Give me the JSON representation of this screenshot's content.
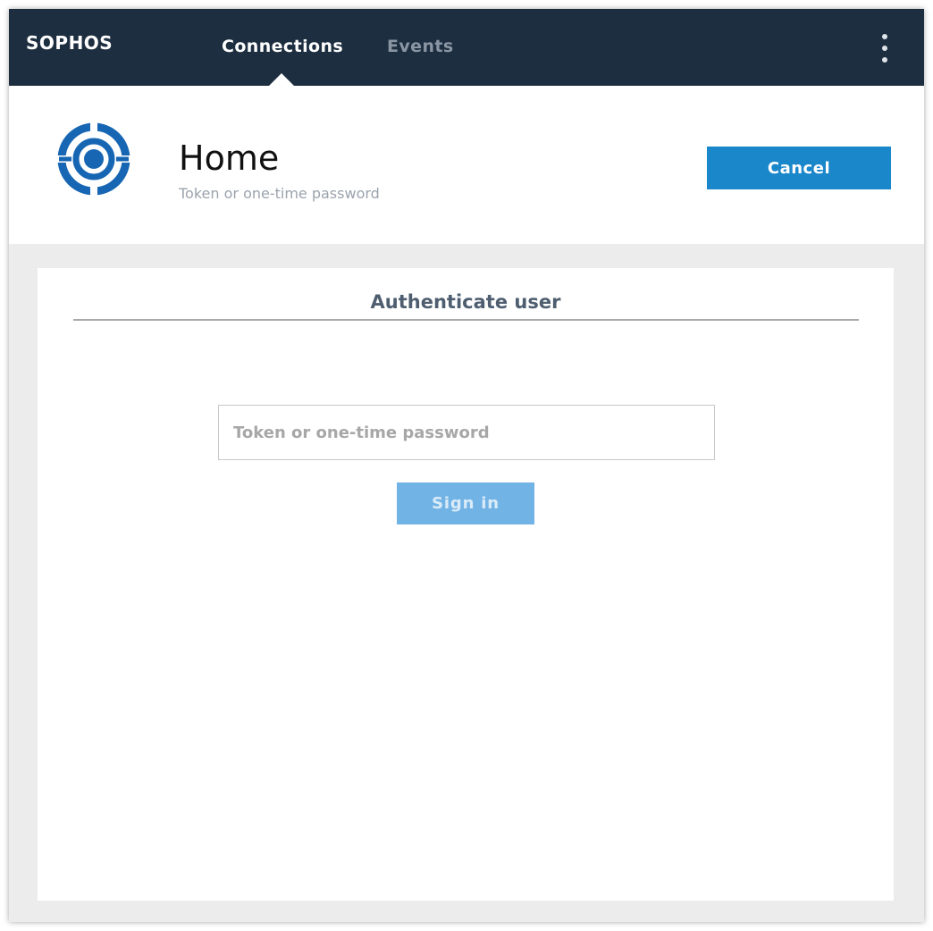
{
  "navbar": {
    "logo": "SOPHOS",
    "tabs": [
      {
        "label": "Connections",
        "active": true
      },
      {
        "label": "Events",
        "active": false
      }
    ],
    "menu_icon": "more-vertical-icon"
  },
  "header": {
    "icon": "connection-target-icon",
    "title": "Home",
    "subtitle": "Token or one-time password",
    "cancel_label": "Cancel"
  },
  "auth": {
    "title": "Authenticate user",
    "input_placeholder": "Token or one-time password",
    "input_value": "",
    "signin_label": "Sign in"
  },
  "colors": {
    "navbar_bg": "#1d2e40",
    "accent": "#1b87cb",
    "signin_disabled": "#72b3e6",
    "page_bg": "#ececec"
  }
}
